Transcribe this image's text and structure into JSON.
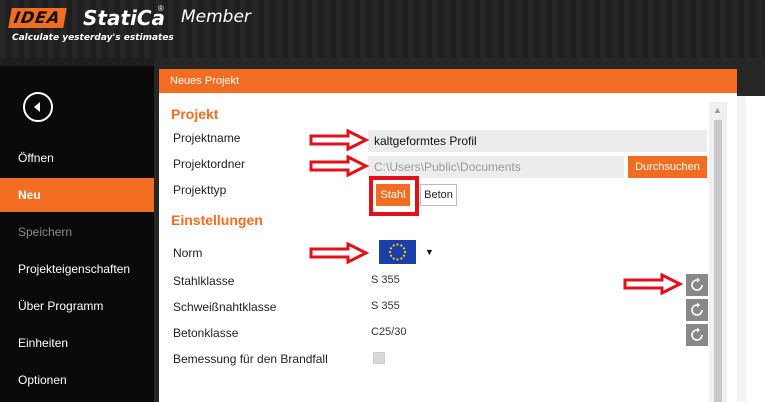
{
  "header": {
    "logo_box": "IDEA",
    "logo_name": "StatiCa",
    "logo_reg": "®",
    "logo_member": "Member",
    "tagline": "Calculate yesterday's estimates"
  },
  "sidebar": {
    "items": [
      {
        "label": "Öffnen",
        "state": "normal"
      },
      {
        "label": "Neu",
        "state": "active"
      },
      {
        "label": "Speichern",
        "state": "disabled"
      },
      {
        "label": "Projekteigenschaften",
        "state": "normal"
      },
      {
        "label": "Über Programm",
        "state": "normal"
      },
      {
        "label": "Einheiten",
        "state": "normal"
      },
      {
        "label": "Optionen",
        "state": "normal"
      }
    ]
  },
  "panel": {
    "title": "Neues Projekt",
    "project_section": {
      "title": "Projekt",
      "name_label": "Projektname",
      "name_value": "kaltgeformtes Profil",
      "folder_label": "Projektordner",
      "folder_value": "C:\\Users\\Public\\Documents",
      "browse_label": "Durchsuchen",
      "type_label": "Projekttyp",
      "type_options": [
        "Stahl",
        "Beton"
      ],
      "type_selected": "Stahl"
    },
    "settings_section": {
      "title": "Einstellungen",
      "norm_label": "Norm",
      "norm_flag": "eu-flag-icon",
      "steel_class_label": "Stahlklasse",
      "steel_class_value": "S 355",
      "weld_class_label": "Schweißnahtklasse",
      "weld_class_value": "S 355",
      "concrete_class_label": "Betonklasse",
      "concrete_class_value": "C25/30",
      "fire_label": "Bemessung für den Brandfall"
    }
  },
  "colors": {
    "accent": "#f26d21",
    "annotation": "#e0111b",
    "sidebar_bg": "#0a0a0a"
  }
}
